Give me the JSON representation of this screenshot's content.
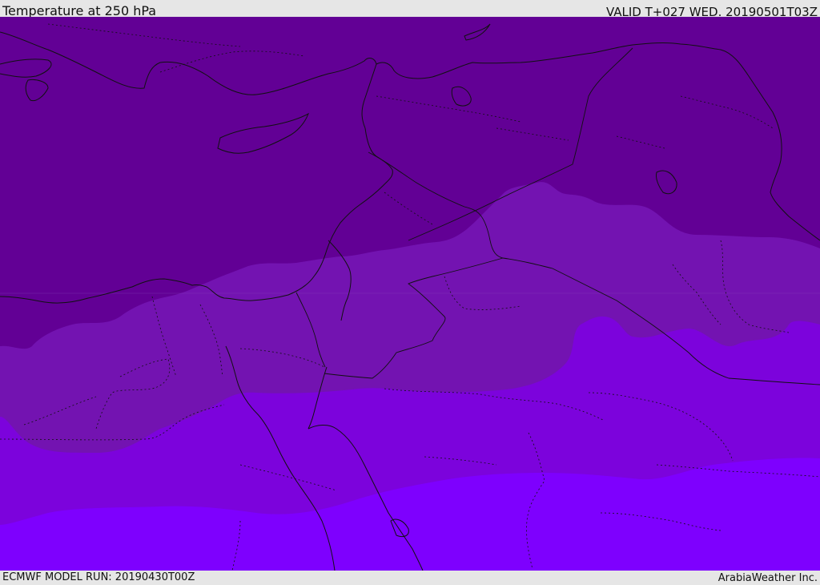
{
  "header": {
    "title": "Temperature at 250 hPa",
    "valid_time": "VALID T+027 WED. 20190501T03Z"
  },
  "footer": {
    "model_run": "ECMWF MODEL RUN: 20190430T00Z",
    "credit": "ArabiaWeather Inc."
  },
  "map": {
    "field": "temperature-250hPa",
    "colors": {
      "coldest_band": "#620095",
      "band_2": "#7313b1",
      "band_3": "#7c03dc",
      "warmest_band": "#7e00fe",
      "land_borders": "#111111"
    }
  }
}
